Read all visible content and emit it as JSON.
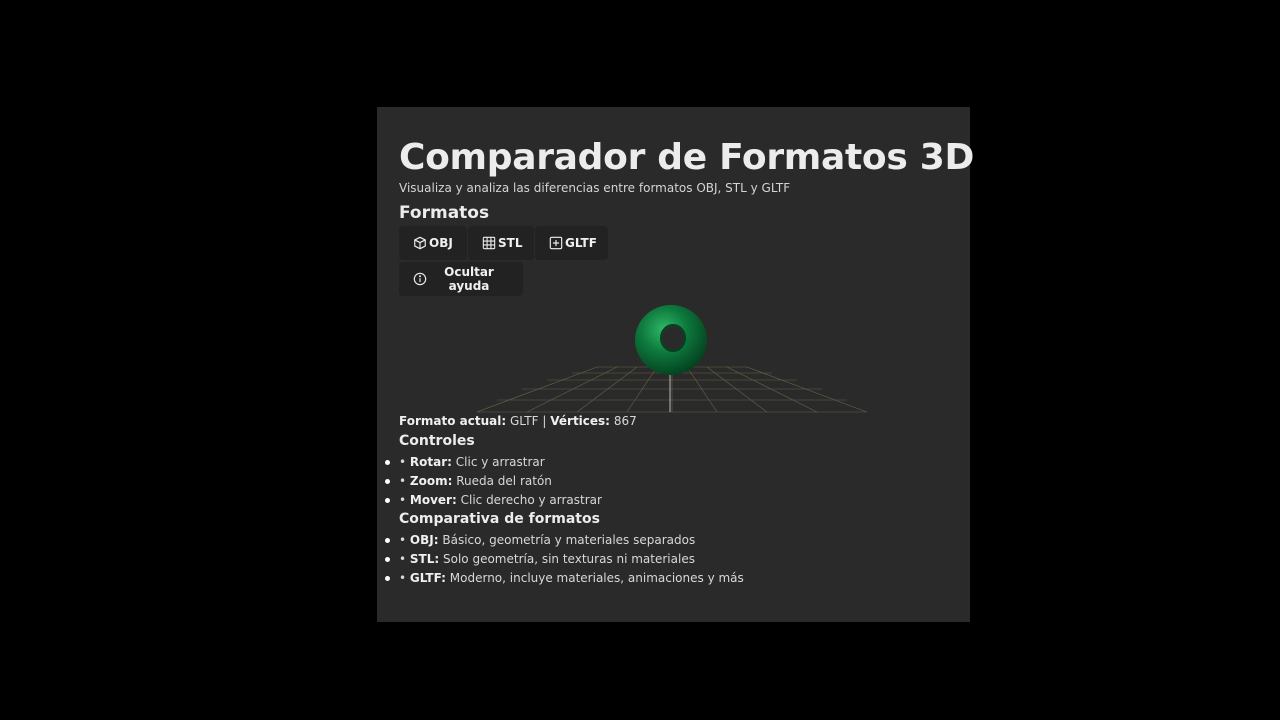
{
  "header": {
    "title": "Comparador de Formatos 3D",
    "subtitle": "Visualiza y analiza las diferencias entre formatos OBJ, STL y GLTF"
  },
  "formats": {
    "section_title": "Formatos",
    "buttons": [
      {
        "label": "OBJ",
        "icon": "cube-icon"
      },
      {
        "label": "STL",
        "icon": "grid-icon"
      },
      {
        "label": "GLTF",
        "icon": "plus-square-icon"
      }
    ],
    "help_button": {
      "label": "Ocultar ayuda",
      "icon": "info-icon"
    }
  },
  "viewer": {
    "model": "torus",
    "model_color": "#0e7a3e",
    "grid_color": "#7a7a3a"
  },
  "status": {
    "format_label": "Formato actual:",
    "format_value": "GLTF",
    "separator": "|",
    "vertices_label": "Vértices:",
    "vertices_value": "867"
  },
  "controls": {
    "title": "Controles",
    "items": [
      {
        "bullet": "•",
        "label": "Rotar:",
        "text": "Clic y arrastrar"
      },
      {
        "bullet": "•",
        "label": "Zoom:",
        "text": "Rueda del ratón"
      },
      {
        "bullet": "•",
        "label": "Mover:",
        "text": "Clic derecho y arrastrar"
      }
    ]
  },
  "comparison": {
    "title": "Comparativa de formatos",
    "items": [
      {
        "bullet": "•",
        "label": "OBJ:",
        "text": "Básico, geometría y materiales separados"
      },
      {
        "bullet": "•",
        "label": "STL:",
        "text": "Solo geometría, sin texturas ni materiales"
      },
      {
        "bullet": "•",
        "label": "GLTF:",
        "text": "Moderno, incluye materiales, animaciones y más"
      }
    ]
  }
}
